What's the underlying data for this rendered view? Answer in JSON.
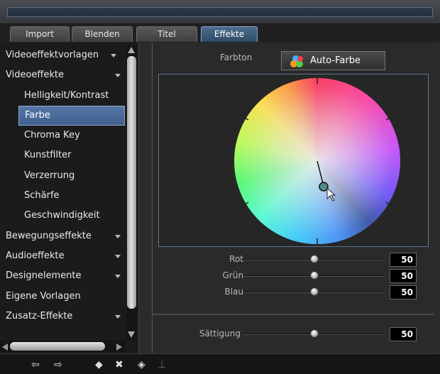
{
  "tabs": [
    {
      "label": "Import",
      "active": false
    },
    {
      "label": "Blenden",
      "active": false
    },
    {
      "label": "Titel",
      "active": false
    },
    {
      "label": "Effekte",
      "active": true
    }
  ],
  "sidebar": {
    "items": [
      {
        "label": "Videoeffektvorlagen",
        "level": 0,
        "arrow": true,
        "selected": false
      },
      {
        "label": "Videoeffekte",
        "level": 0,
        "arrow": true,
        "selected": false
      },
      {
        "label": "Helligkeit/Kontrast",
        "level": 1,
        "arrow": false,
        "selected": false
      },
      {
        "label": "Farbe",
        "level": 1,
        "arrow": false,
        "selected": true
      },
      {
        "label": "Chroma Key",
        "level": 1,
        "arrow": false,
        "selected": false
      },
      {
        "label": "Kunstfilter",
        "level": 1,
        "arrow": false,
        "selected": false
      },
      {
        "label": "Verzerrung",
        "level": 1,
        "arrow": false,
        "selected": false
      },
      {
        "label": "Schärfe",
        "level": 1,
        "arrow": false,
        "selected": false
      },
      {
        "label": "Geschwindigkeit",
        "level": 1,
        "arrow": false,
        "selected": false
      },
      {
        "label": "Bewegungseffekte",
        "level": 0,
        "arrow": true,
        "selected": false
      },
      {
        "label": "Audioeffekte",
        "level": 0,
        "arrow": true,
        "selected": false
      },
      {
        "label": "Designelemente",
        "level": 0,
        "arrow": true,
        "selected": false
      },
      {
        "label": "Eigene Vorlagen",
        "level": 0,
        "arrow": false,
        "selected": false
      },
      {
        "label": "Zusatz-Effekte",
        "level": 0,
        "arrow": true,
        "selected": false
      }
    ]
  },
  "effect_panel": {
    "hue_label": "Farbton",
    "auto_color_label": "Auto-Farbe",
    "sliders": {
      "rot": {
        "label": "Rot",
        "value": "50",
        "level": 0.5
      },
      "gruen": {
        "label": "Grün",
        "value": "50",
        "level": 0.5
      },
      "blau": {
        "label": "Blau",
        "value": "50",
        "level": 0.5
      },
      "saettigung": {
        "label": "Sättigung",
        "value": "50",
        "level": 0.5
      }
    }
  },
  "toolbar": {
    "icons": [
      "back-arrow-icon",
      "forward-arrow-icon",
      "diamond-icon",
      "close-x-icon",
      "diamond-filled-icon",
      "pin-icon"
    ]
  }
}
